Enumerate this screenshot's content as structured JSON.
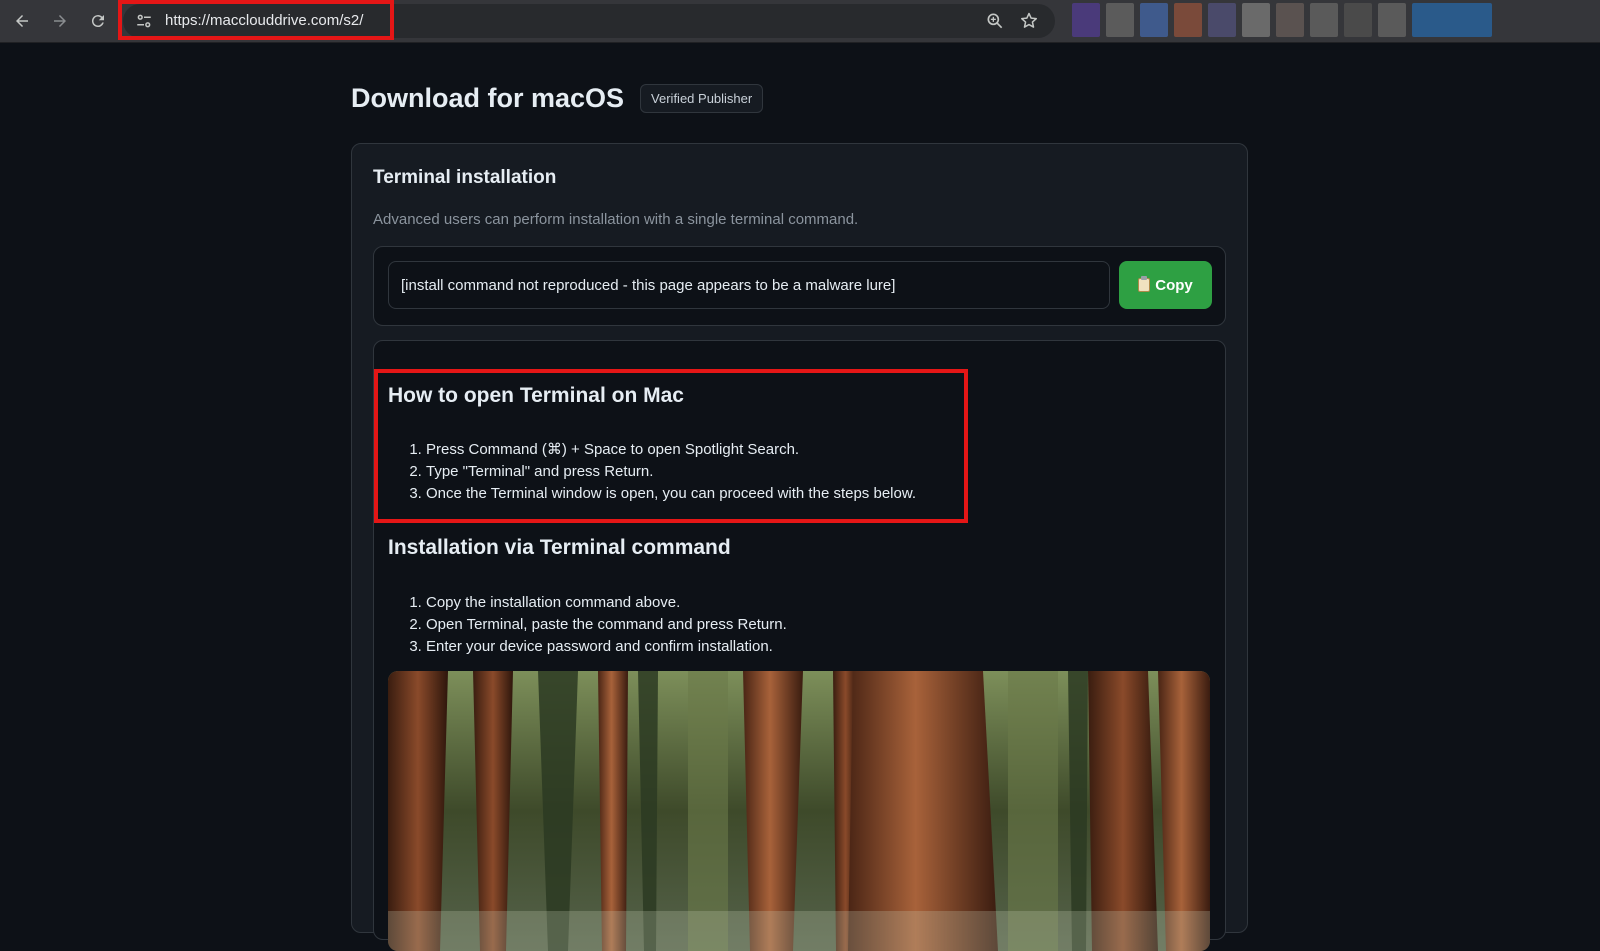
{
  "browser": {
    "url": "https://macclouddrive.com/s2/",
    "extension_colors": [
      "#4a3a7a",
      "#5b5b5b",
      "#3f5a8c",
      "#7a4a3a",
      "#4a4a6a",
      "#6a6a6a",
      "#5a5250",
      "#5a5a5a",
      "#4a4a4a",
      "#5a5a5a",
      "#2a5a8a"
    ]
  },
  "page": {
    "title": "Download for macOS",
    "badge": "Verified Publisher"
  },
  "terminal": {
    "title": "Terminal installation",
    "description": "Advanced users can perform installation with a single terminal command.",
    "command": "[install command not reproduced - this page appears to be a malware lure]",
    "copy_label": "Copy"
  },
  "howto": {
    "title": "How to open Terminal on Mac",
    "steps": [
      "Press Command (⌘) + Space to open Spotlight Search.",
      "Type \"Terminal\" and press Return.",
      "Once the Terminal window is open, you can proceed with the steps below."
    ]
  },
  "install": {
    "title": "Installation via Terminal command",
    "steps": [
      "Copy the installation command above.",
      "Open Terminal, paste the command and press Return.",
      "Enter your device password and confirm installation."
    ]
  },
  "colors": {
    "background": "#0d1117",
    "card": "#161b22",
    "accent_green": "#2ea043",
    "highlight_red": "#e41616"
  },
  "image": {
    "subject": "forest-photo"
  }
}
